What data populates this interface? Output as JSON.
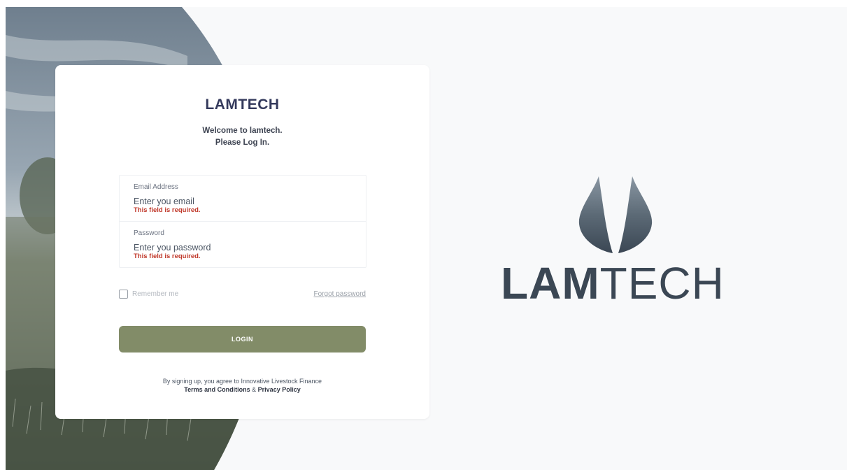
{
  "colors": {
    "page_bg": "#f8f9fa",
    "card_bg": "#ffffff",
    "title": "#343a5c",
    "error": "#c0392b",
    "login_button": "#828c68",
    "logo": "#3b4754"
  },
  "hero": {
    "image": "grass-field-photo"
  },
  "card": {
    "title": "LAMTECH",
    "welcome_line1": "Welcome to lamtech.",
    "welcome_line2": "Please Log In."
  },
  "form": {
    "email": {
      "label": "Email Address",
      "placeholder": "Enter you email",
      "value": "",
      "error": "This field is required."
    },
    "password": {
      "label": "Password",
      "placeholder": "Enter you password",
      "value": "",
      "error": "This field is required."
    },
    "remember_label": "Remember me",
    "remember_checked": false,
    "forgot_label": "Forgot password",
    "login_label": "LOGIN"
  },
  "legal": {
    "line1": "By signing up, you agree to Innovative Livestock Finance",
    "terms": "Terms and Conditions",
    "amp": "&",
    "privacy": "Privacy Policy"
  },
  "brand": {
    "logo_icon": "leaf-drop-icon",
    "name_bold": "LAM",
    "name_light": "TECH"
  }
}
